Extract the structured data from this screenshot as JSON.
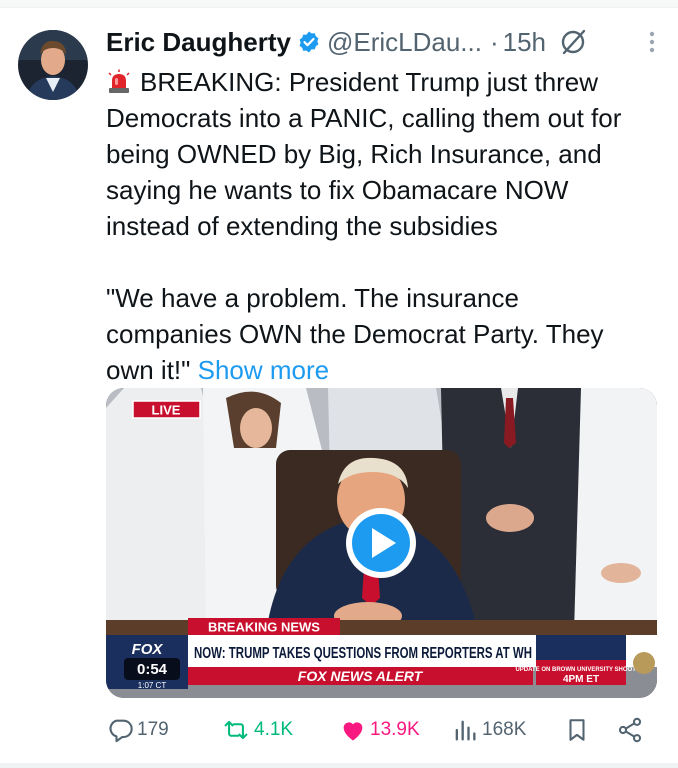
{
  "tweet": {
    "author_name": "Eric Daugherty",
    "handle": "@EricLDau...",
    "separator": "·",
    "time": "15h",
    "text_lines": [
      "BREAKING: President Trump just threw",
      "Democrats into a PANIC, calling them out for",
      "being OWNED by Big, Rich Insurance, and",
      "saying he wants to fix Obamacare NOW",
      "instead of extending the subsidies"
    ],
    "quote_lines": [
      "\"We have a problem. The insurance",
      "companies OWN the Democrat Party. They",
      "own it!\""
    ],
    "show_more": "Show more"
  },
  "video": {
    "live_badge": "LIVE",
    "breaking_news": "BREAKING NEWS",
    "headline": "NOW: TRUMP TAKES QUESTIONS FROM REPORTERS AT WH",
    "alert": "FOX NEWS ALERT",
    "duration": "0:54",
    "network_logo": "FOX",
    "local_time": "1:07 CT",
    "side_promo": "UPDATE ON BROWN UNIVERSITY SHOOTING",
    "side_time": "4PM ET"
  },
  "actions": {
    "replies": "179",
    "reposts": "4.1K",
    "likes": "13.9K",
    "views": "168K"
  },
  "icons": {
    "verified": "verified-badge-icon",
    "grok": "grok-icon",
    "more": "more-options-icon",
    "siren": "siren-emoji-icon",
    "play": "play-icon",
    "reply": "reply-icon",
    "repost": "repost-icon",
    "like": "heart-icon",
    "views": "views-icon",
    "bookmark": "bookmark-icon",
    "share": "share-icon"
  },
  "colors": {
    "accent_blue": "#1d9bf0",
    "like_pink": "#f91880",
    "repost_green": "#00ba7c",
    "muted_text": "#536471",
    "fox_red": "#c8102e"
  }
}
